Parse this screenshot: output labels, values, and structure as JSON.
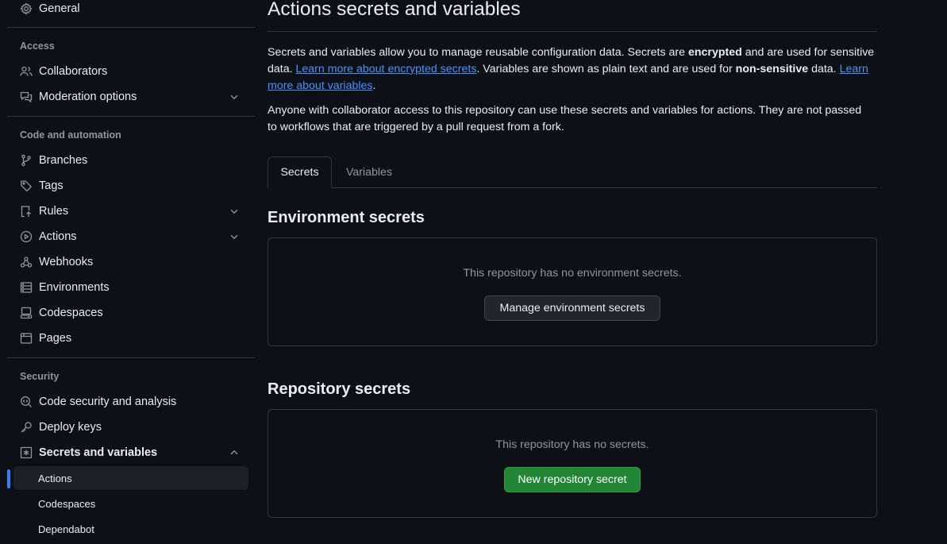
{
  "colors": {
    "background": "#0d1117",
    "accent_blue": "#2f81f7",
    "link": "#4493f8",
    "primary_button": "#238636",
    "muted_text": "#8d96a0"
  },
  "sidebar": {
    "general": {
      "label": "General",
      "icon": "gear-icon"
    },
    "access": {
      "title": "Access",
      "items": [
        {
          "label": "Collaborators",
          "icon": "people-icon"
        },
        {
          "label": "Moderation options",
          "icon": "comment-discussion-icon",
          "expandable": true
        }
      ]
    },
    "code_automation": {
      "title": "Code and automation",
      "items": [
        {
          "label": "Branches",
          "icon": "git-branch-icon"
        },
        {
          "label": "Tags",
          "icon": "tag-icon"
        },
        {
          "label": "Rules",
          "icon": "repo-push-icon",
          "expandable": true
        },
        {
          "label": "Actions",
          "icon": "play-icon",
          "expandable": true
        },
        {
          "label": "Webhooks",
          "icon": "webhook-icon"
        },
        {
          "label": "Environments",
          "icon": "server-icon"
        },
        {
          "label": "Codespaces",
          "icon": "codespaces-icon"
        },
        {
          "label": "Pages",
          "icon": "browser-icon"
        }
      ]
    },
    "security": {
      "title": "Security",
      "items": [
        {
          "label": "Code security and analysis",
          "icon": "codescan-icon"
        },
        {
          "label": "Deploy keys",
          "icon": "key-icon"
        },
        {
          "label": "Secrets and variables",
          "icon": "key-asterisk-icon",
          "expanded": true
        }
      ],
      "sub_items": [
        {
          "label": "Actions",
          "selected": true
        },
        {
          "label": "Codespaces"
        },
        {
          "label": "Dependabot"
        }
      ]
    }
  },
  "main": {
    "title": "Actions secrets and variables",
    "intro": {
      "p1_a": "Secrets and variables allow you to manage reusable configuration data. Secrets are ",
      "p1_b": "encrypted",
      "p1_c": " and are used for sensitive data. ",
      "p1_link1": "Learn more about encrypted secrets",
      "p1_d": ". Variables are shown as plain text and are used for ",
      "p1_e": "non-sensitive",
      "p1_f": " data. ",
      "p1_link2": "Learn more about variables",
      "p1_g": ".",
      "p2": "Anyone with collaborator access to this repository can use these secrets and variables for actions. They are not passed to workflows that are triggered by a pull request from a fork."
    },
    "tabs": [
      {
        "label": "Secrets",
        "active": true
      },
      {
        "label": "Variables",
        "active": false
      }
    ],
    "environment_secrets": {
      "heading": "Environment secrets",
      "empty_message": "This repository has no environment secrets.",
      "button_label": "Manage environment secrets"
    },
    "repository_secrets": {
      "heading": "Repository secrets",
      "empty_message": "This repository has no secrets.",
      "button_label": "New repository secret"
    }
  }
}
